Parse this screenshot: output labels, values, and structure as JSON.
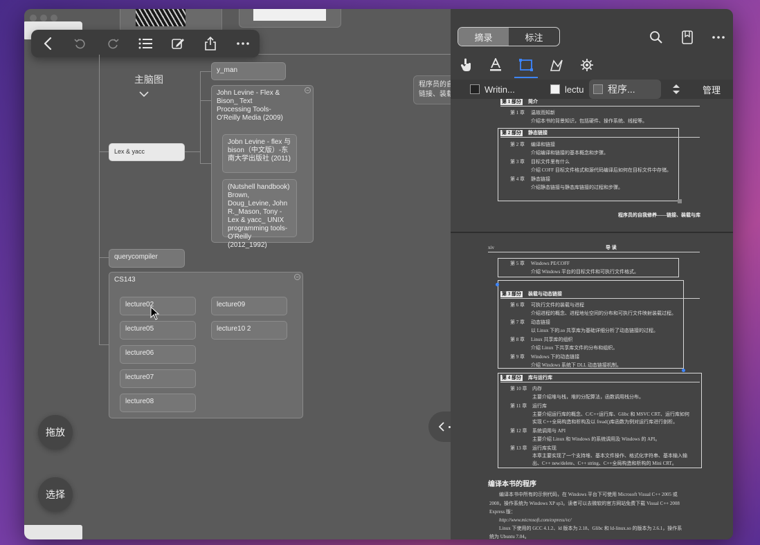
{
  "toolbar": {
    "items": [
      "back-icon",
      "undo-icon",
      "redo-icon",
      "outline-list-icon",
      "edit-icon",
      "share-icon",
      "more-icon"
    ]
  },
  "mindmap": {
    "title": "主脑图",
    "nodes": {
      "y_man": "y_man",
      "levine_group": "John Levine - Flex & Bison_ Text Processing Tools-O'Reilly Media (2009)",
      "levine_cn": "Jobn Levine - flex 与 bison（中文版）-东南大学出版社 (2011)",
      "nutshell": "(Nutshell handbook) Brown, Doug_Levine, John R._Mason, Tony - Lex & yacc_ UNIX programming tools-O'Reilly (2012_1992)",
      "lex_yacc": "Lex & yacc",
      "querycompiler": "querycompiler",
      "cs143": "CS143",
      "lectures_left": [
        "lecture02",
        "lecture05",
        "lecture06",
        "lecture07",
        "lecture08"
      ],
      "lectures_right": [
        "lecture09",
        "lecture10 2"
      ]
    },
    "side_card_text": "程序员的自\n链接、装载"
  },
  "buttons": {
    "drag": "拖放",
    "select": "选择"
  },
  "right": {
    "segments": [
      "摘录",
      "标注"
    ],
    "active_segment": 0,
    "tabs": [
      "Writin...",
      "lectu",
      "程序...",
      "管理"
    ],
    "pdf": {
      "page1": {
        "rows": [
          {
            "label": "第 1 部分",
            "text": "简介"
          },
          {
            "label": "第 1 章",
            "text": "温故而知新"
          },
          {
            "label": "",
            "text": "介绍本书的背景知识，包括硬件、操作系统、线程等。"
          },
          {
            "label": "第 2 部分",
            "text": "静态链接"
          },
          {
            "label": "第 2 章",
            "text": "编译和链接"
          },
          {
            "label": "",
            "text": "介绍编译和链接的基本概念和步骤。"
          },
          {
            "label": "第 3 章",
            "text": "目标文件里有什么"
          },
          {
            "label": "",
            "text": "介绍 COFF 目标文件格式和源代码编译后如何在目标文件中存储。"
          },
          {
            "label": "第 4 章",
            "text": "静态链接"
          },
          {
            "label": "",
            "text": "介绍静态链接与静态库链接的过程和步骤。"
          }
        ],
        "footer": "程序员的自我修养——链接、装载与库"
      },
      "page2": {
        "header_left": "xiv",
        "header_center": "导 读",
        "rows": [
          {
            "label": "第 5 章",
            "text": "Windows PE/COFF"
          },
          {
            "label": "",
            "text": "介绍 Windows 平台的目标文件和可执行文件格式。"
          },
          {
            "label": "第 3 部分",
            "text": "装载与动态链接"
          },
          {
            "label": "第 6 章",
            "text": "可执行文件的装载与进程"
          },
          {
            "label": "",
            "text": "介绍进程的概念、进程地址空间的分布和可执行文件映射装载过程。"
          },
          {
            "label": "第 7 章",
            "text": "动态链接"
          },
          {
            "label": "",
            "text": "以 Linux 下的.so 共享库为基础详细分析了动态链接的过程。"
          },
          {
            "label": "第 8 章",
            "text": "Linux 共享库的组织"
          },
          {
            "label": "",
            "text": "介绍 Linux 下共享库文件的分布和组织。"
          },
          {
            "label": "第 9 章",
            "text": "Windows 下的动态链接"
          },
          {
            "label": "",
            "text": "介绍 Windows 系统下 DLL 动态链接机制。"
          },
          {
            "label": "第 4 部分",
            "text": "库与运行库"
          },
          {
            "label": "第 10 章",
            "text": "内存"
          },
          {
            "label": "",
            "text": "主要介绍堆与栈，堆的分配算法，函数调用栈分布。"
          },
          {
            "label": "第 11 章",
            "text": "运行库"
          },
          {
            "label": "",
            "text": "主要介绍运行库的概念、C/C++运行库、Glibc 和 MSVC CRT、运行库如何"
          },
          {
            "label": "",
            "text": "实现 C++全局构造和析构及以 fread()库函数为例对运行库进行剖析。"
          },
          {
            "label": "第 12 章",
            "text": "系统调用与 API"
          },
          {
            "label": "",
            "text": "主要介绍 Linux 和 Windows 的系统调用及 Windows 的 API。"
          },
          {
            "label": "第 13 章",
            "text": "运行库实现"
          },
          {
            "label": "",
            "text": "本章主要实现了一个支持堆、基本文件操作、格式化字符串、基本输入输"
          },
          {
            "label": "",
            "text": "出、C++ new/delete、C++ string、C++全局构造和析构的 Mini CRT。"
          }
        ],
        "section_title": "编译本书的程序",
        "para": [
          "编译本书中所有的示例代码，在 Windows 平台下可使用 Microsoft Visual C++ 2005 或",
          "2008，操作系统为 Windows XP sp3。读者可以去微软的官方网站免费下载 Visual C++ 2008",
          "Express 版：",
          "http://www.microsoft.com/express/vc/",
          "Linux 下使用的 GCC 4.1.2、ld 版本为 2.18、Glibc 和 ld-linux.so 的版本为 2.6.1，操作系",
          "统为 Ubuntu 7.04。"
        ]
      }
    }
  },
  "colors": {
    "accent": "#3d86ff",
    "canvas": "#5a5a5a",
    "doc_bg": "#444444"
  }
}
